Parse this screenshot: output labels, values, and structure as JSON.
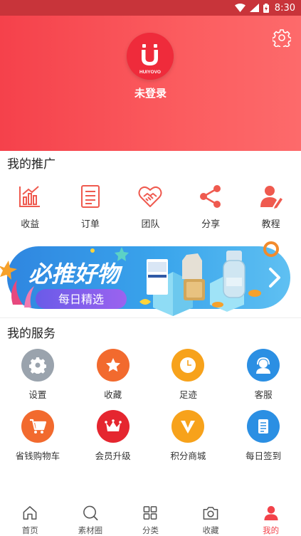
{
  "status_bar": {
    "time": "8:30"
  },
  "header": {
    "login_text": "未登录",
    "logo_letter": "U",
    "logo_text": "HUIYOVO",
    "settings_icon": "gear-icon"
  },
  "promo": {
    "title": "我的推广",
    "items": [
      {
        "label": "收益",
        "icon": "bar-chart-icon"
      },
      {
        "label": "订单",
        "icon": "document-icon"
      },
      {
        "label": "团队",
        "icon": "handshake-heart-icon"
      },
      {
        "label": "分享",
        "icon": "share-icon"
      },
      {
        "label": "教程",
        "icon": "user-pen-icon"
      }
    ]
  },
  "banner": {
    "headline": "必推好物",
    "subline": "每日精选"
  },
  "services": {
    "title": "我的服务",
    "items": [
      {
        "label": "设置",
        "icon": "gear-icon",
        "color": "#9aa3ad"
      },
      {
        "label": "收藏",
        "icon": "star-icon",
        "color": "#f26a2e"
      },
      {
        "label": "足迹",
        "icon": "clock-icon",
        "color": "#f7a21b"
      },
      {
        "label": "客服",
        "icon": "headset-icon",
        "color": "#2b8fe3"
      },
      {
        "label": "省钱购物车",
        "icon": "cart-icon",
        "color": "#f26a2e"
      },
      {
        "label": "会员升级",
        "icon": "crown-icon",
        "color": "#e5262f"
      },
      {
        "label": "积分商城",
        "icon": "v-badge-icon",
        "color": "#f7a21b"
      },
      {
        "label": "每日签到",
        "icon": "notepad-icon",
        "color": "#2b8fe3"
      }
    ]
  },
  "bottom_nav": {
    "items": [
      {
        "label": "首页",
        "icon": "home-icon"
      },
      {
        "label": "素材圈",
        "icon": "search-icon"
      },
      {
        "label": "分类",
        "icon": "grid-icon"
      },
      {
        "label": "收藏",
        "icon": "camera-icon"
      },
      {
        "label": "我的",
        "icon": "person-icon"
      }
    ],
    "active_color": "#f2424a"
  }
}
